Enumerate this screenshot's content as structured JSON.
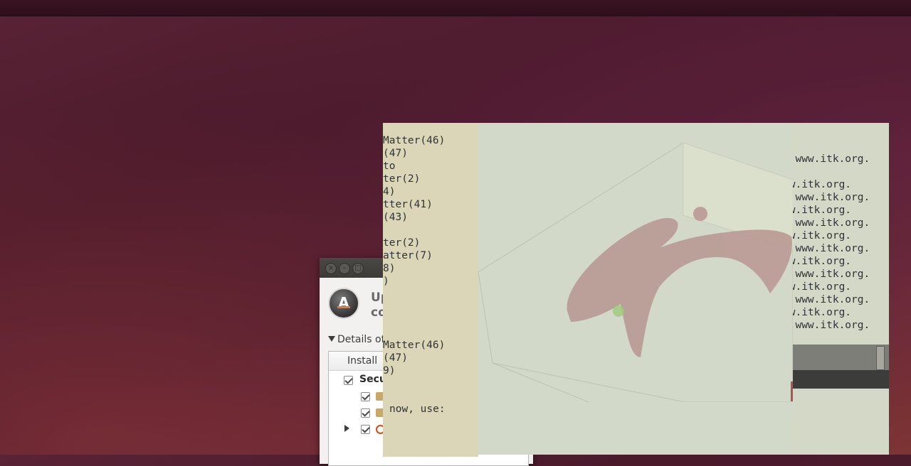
{
  "desktop": {
    "colors": {
      "wallpaper": "#4c1c2e",
      "terminal_bg": "#d4d8c6"
    }
  },
  "updater": {
    "window_buttons": [
      "close",
      "minimize",
      "maximize"
    ],
    "heading_line1": "Up",
    "heading_line2": "co",
    "details_label": "Details of",
    "column_header": "Install",
    "rows": [
      {
        "label": "Secu",
        "checked": true,
        "icon": "none"
      },
      {
        "label": "",
        "checked": true,
        "icon": "package-icon"
      },
      {
        "label": "",
        "checked": true,
        "icon": "package-icon"
      },
      {
        "label": "",
        "checked": true,
        "icon": "ubuntu-icon"
      }
    ]
  },
  "terminal_right": {
    "lines": [
      "o www.itk.org.",
      "",
      "ww.itk.org.",
      "o www.itk.org.",
      "ww.itk.org.",
      "o www.itk.org.",
      "ww.itk.org.",
      "o www.itk.org.",
      "ww.itk.org.",
      "o www.itk.org.",
      "ww.itk.org.",
      "o www.itk.org.",
      "ww.itk.org.",
      "o www.itk.org."
    ]
  },
  "terminal_left": {
    "lines": [
      "Matter(46)",
      "(47)",
      "to",
      "ter(2)",
      "4)",
      "tter(41)",
      "(43)",
      "",
      "ter(2)",
      "atter(7)",
      "8)",
      ")",
      "",
      "",
      "",
      "",
      "Matter(46)",
      "(47)",
      "9)"
    ],
    "bottom_line": "now, use:"
  },
  "viewer": {
    "icon": "3d-volume-render"
  }
}
